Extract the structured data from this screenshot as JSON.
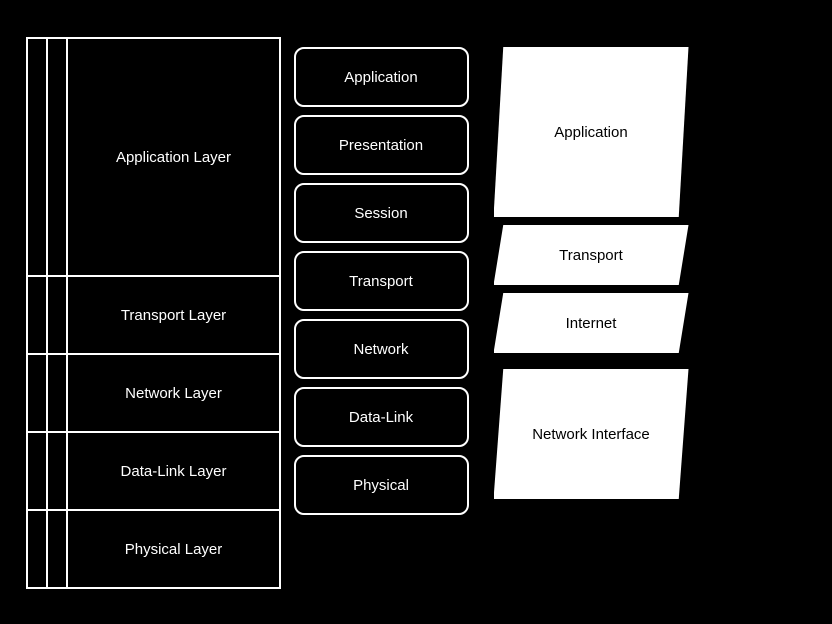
{
  "left": {
    "app_label": "Application Layer",
    "transport_label": "Transport Layer",
    "network_label": "Network Layer",
    "datalink_label": "Data-Link Layer",
    "physical_label": "Physical Layer"
  },
  "middle": {
    "layers": [
      {
        "label": "Application"
      },
      {
        "label": "Presentation"
      },
      {
        "label": "Session"
      },
      {
        "label": "Transport"
      },
      {
        "label": "Network"
      },
      {
        "label": "Data-Link"
      },
      {
        "label": "Physical"
      }
    ]
  },
  "right": {
    "blocks": [
      {
        "label": "Application"
      },
      {
        "label": "Transport"
      },
      {
        "label": "Internet"
      },
      {
        "label": "Network Interface"
      }
    ]
  }
}
